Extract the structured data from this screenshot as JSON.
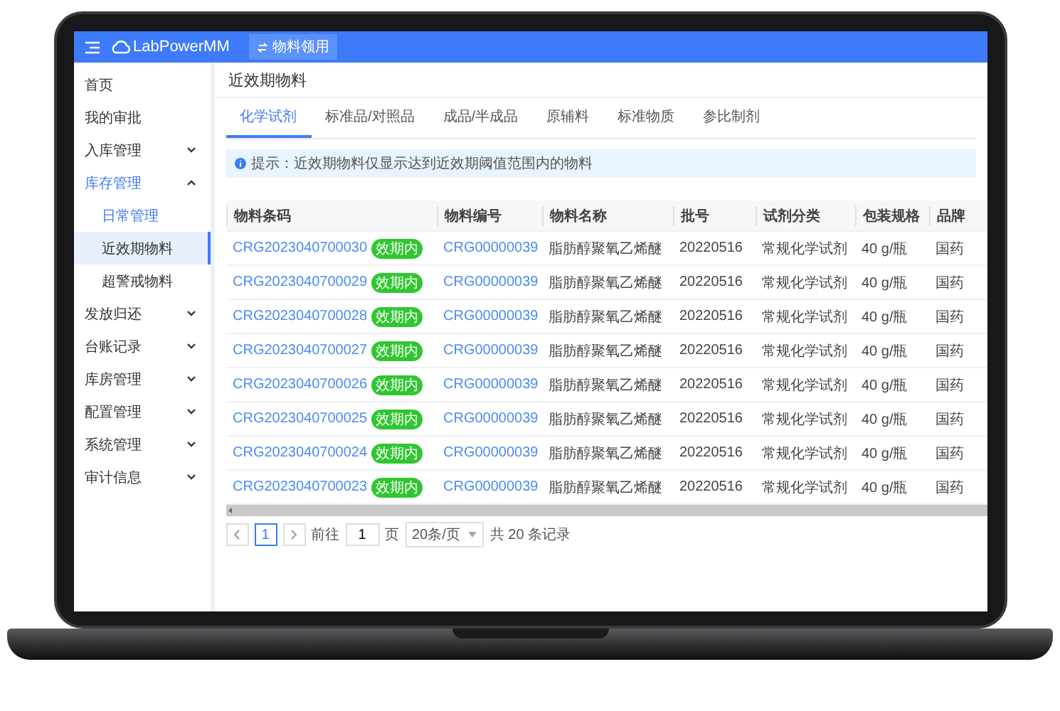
{
  "header": {
    "logo": "LabPowerMM",
    "action_button": "物料领用"
  },
  "sidebar": {
    "items": [
      {
        "label": "首页",
        "kind": "link",
        "selected": false,
        "active": false
      },
      {
        "label": "我的审批",
        "kind": "link",
        "selected": false,
        "active": false
      },
      {
        "label": "入库管理",
        "kind": "group",
        "expanded": false,
        "selected": false,
        "active": false
      },
      {
        "label": "库存管理",
        "kind": "group",
        "expanded": true,
        "selected": false,
        "active": true,
        "children": [
          {
            "label": "日常管理",
            "selected": false,
            "active": true
          },
          {
            "label": "近效期物料",
            "selected": true,
            "active": false
          },
          {
            "label": "超警戒物料",
            "selected": false,
            "active": false
          }
        ]
      },
      {
        "label": "发放归还",
        "kind": "group",
        "expanded": false,
        "selected": false,
        "active": false
      },
      {
        "label": "台账记录",
        "kind": "group",
        "expanded": false,
        "selected": false,
        "active": false
      },
      {
        "label": "库房管理",
        "kind": "group",
        "expanded": false,
        "selected": false,
        "active": false
      },
      {
        "label": "配置管理",
        "kind": "group",
        "expanded": false,
        "selected": false,
        "active": false
      },
      {
        "label": "系统管理",
        "kind": "group",
        "expanded": false,
        "selected": false,
        "active": false
      },
      {
        "label": "审计信息",
        "kind": "group",
        "expanded": false,
        "selected": false,
        "active": false
      }
    ]
  },
  "page_title": "近效期物料",
  "tabs": [
    {
      "label": "化学试剂",
      "selected": true
    },
    {
      "label": "标准品/对照品",
      "selected": false
    },
    {
      "label": "成品/半成品",
      "selected": false
    },
    {
      "label": "原辅料",
      "selected": false
    },
    {
      "label": "标准物质",
      "selected": false
    },
    {
      "label": "参比制剂",
      "selected": false
    }
  ],
  "notice": "提示：近效期物料仅显示达到近效期阈值范围内的物料",
  "table": {
    "columns": [
      "物料条码",
      "物料编号",
      "物料名称",
      "批号",
      "试剂分类",
      "包装规格",
      "品牌"
    ],
    "rows": [
      {
        "barcode": "CRG2023040700030",
        "status": "效期内",
        "code": "CRG00000039",
        "name": "脂肪醇聚氧乙烯醚",
        "batch": "20220516",
        "category": "常规化学试剂",
        "spec": "40 g/瓶",
        "brand": "国药"
      },
      {
        "barcode": "CRG2023040700029",
        "status": "效期内",
        "code": "CRG00000039",
        "name": "脂肪醇聚氧乙烯醚",
        "batch": "20220516",
        "category": "常规化学试剂",
        "spec": "40 g/瓶",
        "brand": "国药"
      },
      {
        "barcode": "CRG2023040700028",
        "status": "效期内",
        "code": "CRG00000039",
        "name": "脂肪醇聚氧乙烯醚",
        "batch": "20220516",
        "category": "常规化学试剂",
        "spec": "40 g/瓶",
        "brand": "国药"
      },
      {
        "barcode": "CRG2023040700027",
        "status": "效期内",
        "code": "CRG00000039",
        "name": "脂肪醇聚氧乙烯醚",
        "batch": "20220516",
        "category": "常规化学试剂",
        "spec": "40 g/瓶",
        "brand": "国药"
      },
      {
        "barcode": "CRG2023040700026",
        "status": "效期内",
        "code": "CRG00000039",
        "name": "脂肪醇聚氧乙烯醚",
        "batch": "20220516",
        "category": "常规化学试剂",
        "spec": "40 g/瓶",
        "brand": "国药"
      },
      {
        "barcode": "CRG2023040700025",
        "status": "效期内",
        "code": "CRG00000039",
        "name": "脂肪醇聚氧乙烯醚",
        "batch": "20220516",
        "category": "常规化学试剂",
        "spec": "40 g/瓶",
        "brand": "国药"
      },
      {
        "barcode": "CRG2023040700024",
        "status": "效期内",
        "code": "CRG00000039",
        "name": "脂肪醇聚氧乙烯醚",
        "batch": "20220516",
        "category": "常规化学试剂",
        "spec": "40 g/瓶",
        "brand": "国药"
      },
      {
        "barcode": "CRG2023040700023",
        "status": "效期内",
        "code": "CRG00000039",
        "name": "脂肪醇聚氧乙烯醚",
        "batch": "20220516",
        "category": "常规化学试剂",
        "spec": "40 g/瓶",
        "brand": "国药"
      }
    ]
  },
  "pagination": {
    "pages": [
      {
        "label": "1",
        "selected": true
      }
    ],
    "goto_label": "前往",
    "goto_value": "1",
    "page_unit": "页",
    "page_size": "20条/页",
    "total": "共 20 条记录"
  }
}
